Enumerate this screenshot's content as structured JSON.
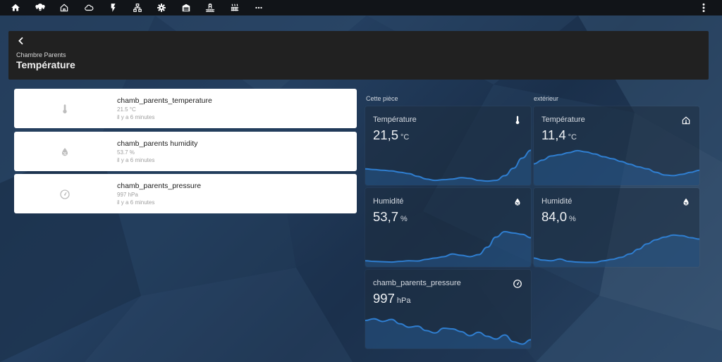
{
  "topbar": {
    "tabs": [
      {
        "icon": "home-icon"
      },
      {
        "icon": "lightbulb-group-icon"
      },
      {
        "icon": "home-outline-icon"
      },
      {
        "icon": "cloud-icon"
      },
      {
        "icon": "flash-icon"
      },
      {
        "icon": "network-icon"
      },
      {
        "icon": "cog-icon"
      },
      {
        "icon": "garage-icon"
      },
      {
        "icon": "pool-icon"
      },
      {
        "icon": "radiator-icon"
      },
      {
        "icon": "more-horiz-icon"
      }
    ],
    "menu_icon": "dots-vertical-icon"
  },
  "header": {
    "parent": "Chambre Parents",
    "title": "Température"
  },
  "entities": [
    {
      "name": "chamb_parents_temperature",
      "state": "21.5 °C",
      "time": "il y a 6 minutes",
      "icon": "thermometer-icon"
    },
    {
      "name": "chamb_parents humidity",
      "state": "53.7 %",
      "time": "il y a 6 minutes",
      "icon": "water-percent-icon"
    },
    {
      "name": "chamb_parents_pressure",
      "state": "997 hPa",
      "time": "il y a 6 minutes",
      "icon": "gauge-icon"
    }
  ],
  "columns": {
    "room": "Cette pièce",
    "outside": "extérieur"
  },
  "sensors": {
    "room_temp": {
      "name": "Température",
      "value": "21,5",
      "unit": "°C",
      "icon": "thermometer-icon",
      "history": [
        0.4,
        0.38,
        0.36,
        0.34,
        0.3,
        0.26,
        0.18,
        0.1,
        0.06,
        0.08,
        0.1,
        0.14,
        0.12,
        0.06,
        0.04,
        0.06,
        0.2,
        0.42,
        0.72,
        0.95
      ]
    },
    "room_humidity": {
      "name": "Humidité",
      "value": "53,7",
      "unit": "%",
      "icon": "water-percent-icon",
      "history": [
        0.1,
        0.08,
        0.07,
        0.06,
        0.08,
        0.1,
        0.09,
        0.14,
        0.18,
        0.22,
        0.3,
        0.26,
        0.22,
        0.28,
        0.5,
        0.8,
        0.96,
        0.92,
        0.88,
        0.78
      ]
    },
    "pressure": {
      "name": "chamb_parents_pressure",
      "value": "997",
      "unit": "hPa",
      "icon": "gauge-icon",
      "history": [
        0.75,
        0.8,
        0.72,
        0.78,
        0.65,
        0.55,
        0.58,
        0.45,
        0.38,
        0.52,
        0.5,
        0.42,
        0.3,
        0.4,
        0.28,
        0.2,
        0.32,
        0.12,
        0.05,
        0.18
      ]
    },
    "out_temp": {
      "name": "Température",
      "value": "11,4",
      "unit": "°C",
      "icon": "home-thermometer-icon",
      "history": [
        0.55,
        0.66,
        0.78,
        0.82,
        0.88,
        0.94,
        0.9,
        0.84,
        0.76,
        0.7,
        0.62,
        0.54,
        0.46,
        0.4,
        0.3,
        0.22,
        0.2,
        0.24,
        0.3,
        0.36
      ]
    },
    "out_humidity": {
      "name": "Humidité",
      "value": "84,0",
      "unit": "%",
      "icon": "water-percent-icon",
      "history": [
        0.18,
        0.12,
        0.1,
        0.15,
        0.08,
        0.06,
        0.05,
        0.05,
        0.1,
        0.14,
        0.2,
        0.3,
        0.44,
        0.6,
        0.72,
        0.8,
        0.86,
        0.84,
        0.78,
        0.74
      ]
    }
  },
  "colors": {
    "topbar_bg": "#111418",
    "header_bg": "#212121",
    "spark_line": "#2f7ed0",
    "spark_fill": "rgba(47,126,208,0.28)"
  }
}
